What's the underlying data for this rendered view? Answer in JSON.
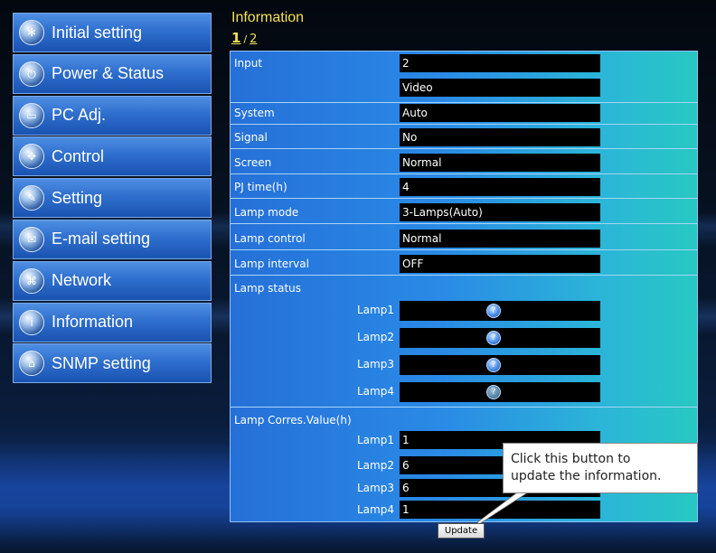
{
  "sidebar": {
    "items": [
      {
        "label": "Initial setting",
        "icon": "gear-icon"
      },
      {
        "label": "Power & Status",
        "icon": "power-icon"
      },
      {
        "label": "PC Adj.",
        "icon": "monitor-icon"
      },
      {
        "label": "Control",
        "icon": "dpad-icon"
      },
      {
        "label": "Setting",
        "icon": "wrench-icon"
      },
      {
        "label": "E-mail setting",
        "icon": "envelope-icon"
      },
      {
        "label": "Network",
        "icon": "network-icon"
      },
      {
        "label": "Information",
        "icon": "info-icon"
      },
      {
        "label": "SNMP setting",
        "icon": "snmp-icon"
      }
    ]
  },
  "page": {
    "title": "Information",
    "pager": {
      "current": "1",
      "separator": "/",
      "next": "2"
    }
  },
  "info": {
    "input_label": "Input",
    "input_value": "2",
    "input_value2": "Video",
    "rows": [
      {
        "label": "System",
        "value": "Auto"
      },
      {
        "label": "Signal",
        "value": "No"
      },
      {
        "label": "Screen",
        "value": "Normal"
      },
      {
        "label": "PJ time(h)",
        "value": "4"
      },
      {
        "label": "Lamp mode",
        "value": "3-Lamps(Auto)"
      },
      {
        "label": "Lamp control",
        "value": "Normal"
      },
      {
        "label": "Lamp interval",
        "value": "OFF"
      }
    ],
    "lamp_status_label": "Lamp status",
    "lamp_status": [
      {
        "label": "Lamp1",
        "state": "on"
      },
      {
        "label": "Lamp2",
        "state": "on"
      },
      {
        "label": "Lamp3",
        "state": "on"
      },
      {
        "label": "Lamp4",
        "state": "dim"
      }
    ],
    "lamp_corres_label": "Lamp Corres.Value(h)",
    "lamp_corres": [
      {
        "label": "Lamp1",
        "value": "1"
      },
      {
        "label": "Lamp2",
        "value": "6"
      },
      {
        "label": "Lamp3",
        "value": "6"
      },
      {
        "label": "Lamp4",
        "value": "1"
      }
    ]
  },
  "update_button": {
    "label": "Update"
  },
  "callout": {
    "line1": "Click this button to",
    "line2": "update the information."
  },
  "colors": {
    "title": "#f4e25a",
    "panel_start": "#2570d8",
    "panel_end": "#27c8c2",
    "value_box": "#000000"
  }
}
